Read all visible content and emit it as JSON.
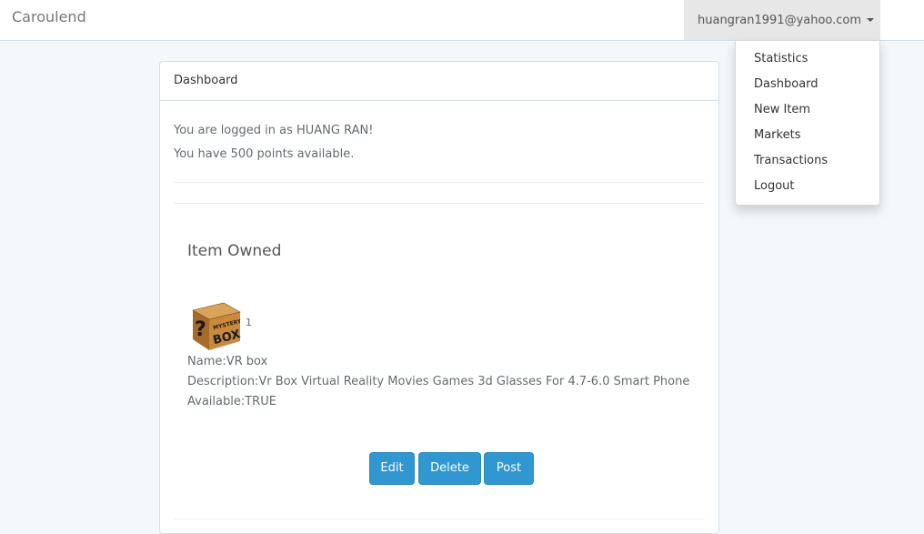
{
  "navbar": {
    "brand": "Caroulend",
    "user_email": "huangran1991@yahoo.com"
  },
  "dropdown": {
    "items": [
      {
        "label": "Statistics"
      },
      {
        "label": "Dashboard"
      },
      {
        "label": "New Item"
      },
      {
        "label": "Markets"
      },
      {
        "label": "Transactions"
      },
      {
        "label": "Logout"
      }
    ]
  },
  "panel": {
    "heading": "Dashboard",
    "logged_in_text": "You are logged in as HUANG RAN!",
    "points_text": "You have 500 points available."
  },
  "items_owned": {
    "title": "Item Owned",
    "item": {
      "image_alt": "Mystery box",
      "image_text_top": "MYSTERY",
      "image_text_bottom": "BOX",
      "image_symbol": "?",
      "quantity": "1",
      "name": "Name:VR box",
      "description": "Description:Vr Box Virtual Reality Movies Games 3d Glasses For 4.7-6.0 Smart Phone",
      "available": "Available:TRUE"
    },
    "buttons": {
      "edit": "Edit",
      "delete": "Delete",
      "post": "Post"
    }
  },
  "colors": {
    "primary": "#3097d1",
    "background": "#f5f8fa",
    "border": "#d3e0e9"
  }
}
